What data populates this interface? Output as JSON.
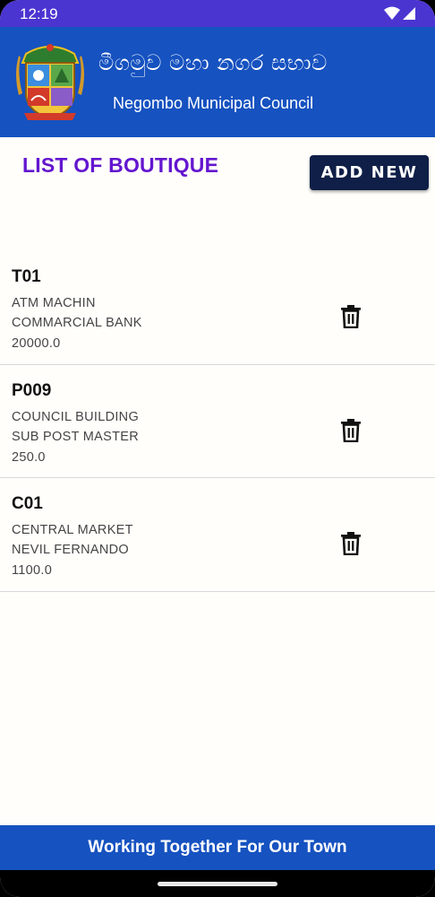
{
  "status_bar": {
    "time": "12:19",
    "icons": [
      "wifi-icon",
      "signal-icon"
    ]
  },
  "header": {
    "title_sinhala": "මීගමුව මහා නගර සභාව",
    "title_english": "Negombo Municipal Council",
    "logo": "municipal-crest-logo"
  },
  "page": {
    "title": "LIST OF BOUTIQUE",
    "add_button": "ADD NEW"
  },
  "boutiques": [
    {
      "code": "T01",
      "location": "ATM MACHIN",
      "tenant": "COMMARCIAL  BANK",
      "amount": "20000.0"
    },
    {
      "code": "P009",
      "location": "COUNCIL BUILDING",
      "tenant": "SUB POST MASTER",
      "amount": "250.0"
    },
    {
      "code": "C01",
      "location": "CENTRAL MARKET",
      "tenant": "NEVIL FERNANDO",
      "amount": "1100.0"
    }
  ],
  "footer": {
    "text": "Working Together For Our Town"
  },
  "colors": {
    "status_bar": "#4a35d1",
    "header": "#1652c0",
    "title": "#6316cf",
    "button": "#0f1f47"
  }
}
